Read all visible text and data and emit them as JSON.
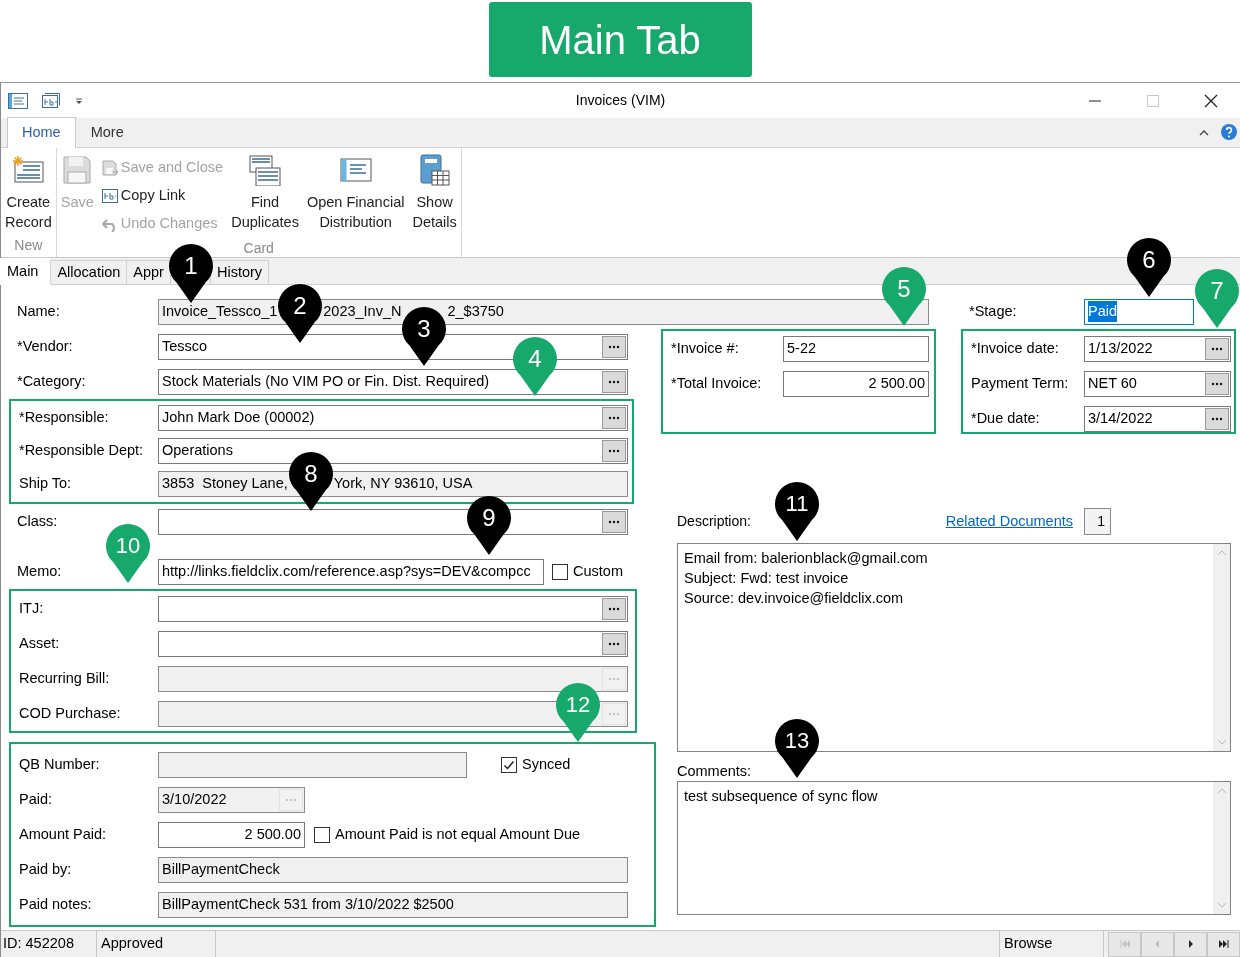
{
  "banner": {
    "label": "Main Tab"
  },
  "window": {
    "title": "Invoices (VIM)"
  },
  "ribbon": {
    "tabs": [
      {
        "label": "Home",
        "selected": true
      },
      {
        "label": "More",
        "selected": false
      }
    ],
    "groups": [
      {
        "label": "New",
        "items": [
          {
            "kind": "large",
            "label": "Create\nRecord",
            "disabled": false
          }
        ]
      },
      {
        "label": "Card",
        "items": [
          {
            "kind": "large",
            "label": "Save",
            "disabled": true
          },
          {
            "kind": "small",
            "label": "Save and Close",
            "disabled": true
          },
          {
            "kind": "small",
            "label": "Copy Link",
            "disabled": false
          },
          {
            "kind": "small",
            "label": "Undo Changes",
            "disabled": true
          },
          {
            "kind": "large",
            "label": "Find\nDuplicates",
            "disabled": false
          },
          {
            "kind": "large",
            "label": "Open Financial\nDistribution",
            "disabled": false
          },
          {
            "kind": "large",
            "label": "Show\nDetails",
            "disabled": false
          }
        ]
      }
    ]
  },
  "tabs": [
    {
      "label": "Main",
      "selected": true
    },
    {
      "label": "Allocation",
      "selected": false
    },
    {
      "label": "Appr",
      "selected": false
    },
    {
      "label": "History",
      "selected": false
    }
  ],
  "form": {
    "name": {
      "label": "Name:",
      "value_parts": [
        "Invoice_Tessco_1",
        "2023_Inv_N",
        "2_$3750"
      ],
      "readonly": true,
      "has_button": false
    },
    "stage": {
      "label": "*Stage:",
      "value": "Paid",
      "focused": true
    },
    "main_fields": [
      {
        "label": "*Vendor:",
        "value": "Tessco",
        "readonly": false,
        "numeric": false,
        "has_button": true,
        "button_disabled": false
      },
      {
        "label": "*Category:",
        "value": "Stock Materials (No VIM PO or Fin. Dist. Required)",
        "readonly": false,
        "numeric": false,
        "has_button": true,
        "button_disabled": false
      }
    ],
    "responsible_group": [
      {
        "label": "*Responsible:",
        "value": "John Mark Doe (00002)",
        "readonly": false,
        "numeric": false,
        "has_button": true,
        "button_disabled": false
      },
      {
        "label": "*Responsible Dept:",
        "value": "Operations",
        "readonly": false,
        "numeric": false,
        "has_button": true,
        "button_disabled": false
      },
      {
        "label": "Ship To:",
        "value_parts": [
          "3853  Stoney Lane,",
          "York, NY 93610, USA"
        ],
        "readonly": true,
        "has_button": false
      }
    ],
    "invoice_group": [
      {
        "label": "*Invoice #:",
        "value": "5-22",
        "readonly": false,
        "numeric": false,
        "has_button": false
      },
      {
        "label": "*Total Invoice:",
        "value": "2 500.00",
        "readonly": false,
        "numeric": true,
        "has_button": false
      }
    ],
    "dates_group": [
      {
        "label": "*Invoice date:",
        "value": "1/13/2022",
        "readonly": false,
        "numeric": false,
        "has_button": true,
        "button_disabled": false
      },
      {
        "label": "Payment Term:",
        "value": "NET 60",
        "readonly": false,
        "numeric": false,
        "has_button": true,
        "button_disabled": false
      },
      {
        "label": "*Due date:",
        "value": "3/14/2022",
        "readonly": false,
        "numeric": false,
        "has_button": true,
        "button_disabled": false
      }
    ],
    "class": {
      "label": "Class:",
      "readonly": false,
      "has_button": true,
      "button_disabled": false
    },
    "memo": {
      "label": "Memo:",
      "value": "http://links.fieldclix.com/reference.asp?sys=DEV&compcc",
      "readonly": false,
      "numeric": false,
      "has_button": false,
      "checkbox": {
        "label": "Custom",
        "checked": false
      }
    },
    "lookup_group": [
      {
        "label": "ITJ:",
        "readonly": false,
        "has_button": true,
        "button_disabled": false
      },
      {
        "label": "Asset:",
        "readonly": false,
        "has_button": true,
        "button_disabled": false
      },
      {
        "label": "Recurring Bill:",
        "readonly": true,
        "has_button": true,
        "button_disabled": true
      },
      {
        "label": "COD Purchase:",
        "readonly": true,
        "has_button": true,
        "button_disabled": true
      }
    ],
    "payment_group": [
      {
        "label": "QB Number:",
        "readonly": true,
        "has_button": false,
        "checkbox": {
          "label": "Synced",
          "checked": true
        }
      },
      {
        "label": "Paid:",
        "value": "3/10/2022",
        "readonly": true,
        "numeric": false,
        "has_button": true,
        "button_disabled": true
      },
      {
        "label": "Amount Paid:",
        "value": "2 500.00",
        "readonly": false,
        "numeric": true,
        "has_button": false,
        "checkbox": {
          "label": "Amount Paid is not equal Amount Due",
          "checked": false
        }
      },
      {
        "label": "Paid by:",
        "value": "BillPaymentCheck",
        "readonly": true,
        "numeric": false,
        "has_button": false
      },
      {
        "label": "Paid notes:",
        "value": "BillPaymentCheck 531 from 3/10/2022 $2500",
        "readonly": true,
        "numeric": false,
        "has_button": false
      }
    ],
    "description": {
      "label": "Description:",
      "link": "Related Documents",
      "count": "1",
      "lines": [
        "Email from: balerionblack@gmail.com",
        "Subject: Fwd: test invoice",
        "Source: dev.invoice@fieldclix.com"
      ]
    },
    "comments": {
      "label": "Comments:",
      "lines": [
        "test subsequence of sync flow"
      ]
    }
  },
  "status_bar": {
    "id": "ID: 452208",
    "state": "Approved",
    "mode": "Browse",
    "nav": [
      {
        "disabled": true
      },
      {
        "disabled": true
      },
      {
        "disabled": false
      },
      {
        "disabled": false
      }
    ]
  },
  "callouts": [
    {
      "number": "1",
      "color": "#000000"
    },
    {
      "number": "2",
      "color": "#000000"
    },
    {
      "number": "3",
      "color": "#000000"
    },
    {
      "number": "4",
      "color": "#17a86c"
    },
    {
      "number": "5",
      "color": "#17a86c"
    },
    {
      "number": "6",
      "color": "#000000"
    },
    {
      "number": "7",
      "color": "#17a86c"
    },
    {
      "number": "8",
      "color": "#000000"
    },
    {
      "number": "9",
      "color": "#000000"
    },
    {
      "number": "10",
      "color": "#17a86c"
    },
    {
      "number": "11",
      "color": "#000000"
    },
    {
      "number": "12",
      "color": "#17a86c"
    },
    {
      "number": "13",
      "color": "#000000"
    }
  ]
}
